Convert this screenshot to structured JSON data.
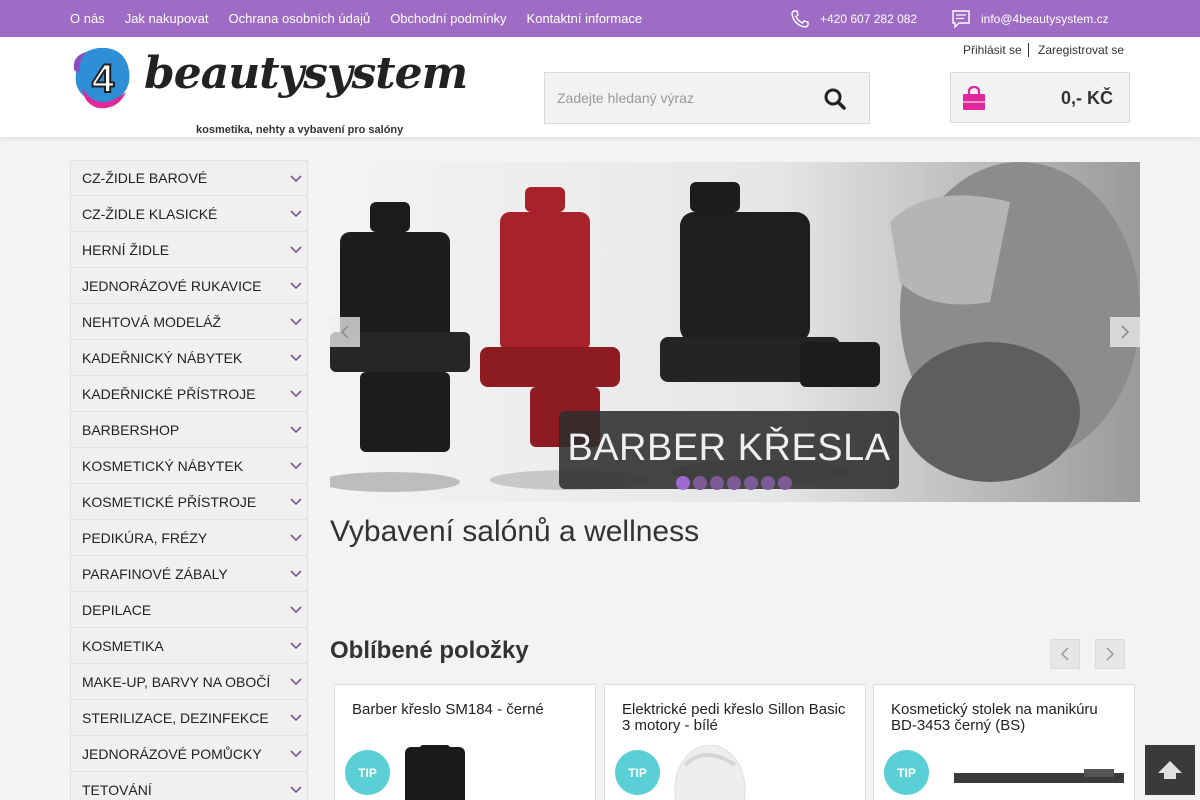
{
  "topbar": {
    "links": [
      "O nás",
      "Jak nakupovat",
      "Ochrana osobních údajů",
      "Obchodní podmínky",
      "Kontaktní informace"
    ],
    "phone": "+420 607 282 082",
    "email": "info@4beautysystem.cz",
    "phone_icon": "phone-icon",
    "email_icon": "message-icon"
  },
  "header": {
    "logo_number": "4",
    "logo_word": "beautysystem",
    "logo_tagline": "kosmetika, nehty a vybavení pro salóny",
    "login": "Přihlásit se",
    "register": "Zaregistrovat se",
    "search_placeholder": "Zadejte hledaný výraz",
    "cart_total": "0,- KČ"
  },
  "sidebar": {
    "categories": [
      "CZ-ŽIDLE BAROVÉ",
      "CZ-ŽIDLE KLASICKÉ",
      "HERNÍ ŽIDLE",
      "JEDNORÁZOVÉ RUKAVICE",
      "NEHTOVÁ MODELÁŽ",
      "KADEŘNICKÝ NÁBYTEK",
      "KADEŘNICKÉ PŘÍSTROJE",
      "BARBERSHOP",
      "KOSMETICKÝ NÁBYTEK",
      "KOSMETICKÉ PŘÍSTROJE",
      "PEDIKÚRA, FRÉZY",
      "PARAFINOVÉ ZÁBALY",
      "DEPILACE",
      "KOSMETIKA",
      "MAKE-UP, BARVY NA OBOČÍ",
      "STERILIZACE, DEZINFEKCE",
      "JEDNORÁZOVÉ POMŮCKY",
      "TETOVÁNÍ"
    ]
  },
  "slider": {
    "caption": "BARBER KŘESLA",
    "slide_count": 7,
    "active_index": 0
  },
  "main": {
    "page_title": "Vybavení salónů a wellness",
    "section_title": "Oblíbené položky"
  },
  "products": [
    {
      "name": "Barber křeslo SM184 - černé",
      "badge": "TIP"
    },
    {
      "name": "Elektrické pedi křeslo Sillon Basic 3 motory - bílé",
      "badge": "TIP"
    },
    {
      "name": "Kosmetický stolek na manikúru BD-3453 černý (BS)",
      "badge": "TIP"
    }
  ],
  "colors": {
    "brand_purple": "#9e6cc4",
    "cart_pink": "#e0289b",
    "tip_teal": "#5ad0d6"
  }
}
